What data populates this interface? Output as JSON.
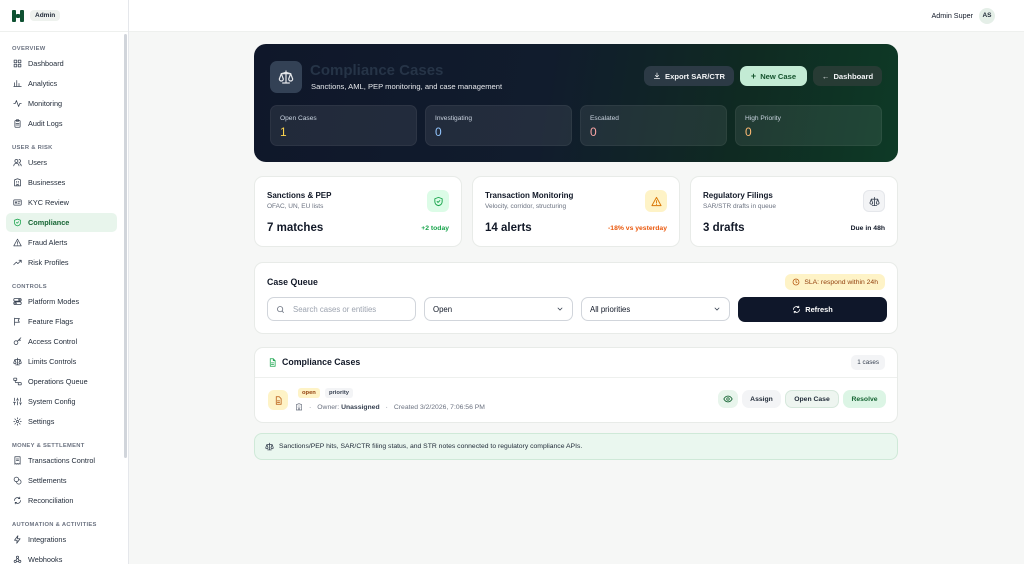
{
  "brand": {
    "badge": "Admin",
    "color": "#0f5132"
  },
  "topbar": {
    "user_name": "Admin Super",
    "avatar_initials": "AS"
  },
  "sidebar": {
    "sections": [
      {
        "title": "OVERVIEW",
        "items": [
          {
            "label": "Dashboard",
            "icon": "grid-icon"
          },
          {
            "label": "Analytics",
            "icon": "bar-chart-icon"
          },
          {
            "label": "Monitoring",
            "icon": "activity-icon"
          },
          {
            "label": "Audit Logs",
            "icon": "clipboard-icon"
          }
        ]
      },
      {
        "title": "USER & RISK",
        "items": [
          {
            "label": "Users",
            "icon": "users-icon"
          },
          {
            "label": "Businesses",
            "icon": "building-icon"
          },
          {
            "label": "KYC Review",
            "icon": "id-card-icon"
          },
          {
            "label": "Compliance",
            "icon": "shield-check-icon",
            "active": true
          },
          {
            "label": "Fraud Alerts",
            "icon": "alert-triangle-icon"
          },
          {
            "label": "Risk Profiles",
            "icon": "trending-up-icon"
          }
        ]
      },
      {
        "title": "CONTROLS",
        "items": [
          {
            "label": "Platform Modes",
            "icon": "toggles-icon"
          },
          {
            "label": "Feature Flags",
            "icon": "flag-icon"
          },
          {
            "label": "Access Control",
            "icon": "key-icon"
          },
          {
            "label": "Limits Controls",
            "icon": "scale-icon"
          },
          {
            "label": "Operations Queue",
            "icon": "workflow-icon"
          },
          {
            "label": "System Config",
            "icon": "sliders-icon"
          },
          {
            "label": "Settings",
            "icon": "gear-icon"
          }
        ]
      },
      {
        "title": "MONEY & SETTLEMENT",
        "items": [
          {
            "label": "Transactions Control",
            "icon": "receipt-icon"
          },
          {
            "label": "Settlements",
            "icon": "coins-icon"
          },
          {
            "label": "Reconciliation",
            "icon": "refresh-icon"
          }
        ]
      },
      {
        "title": "AUTOMATION & ACTIVITIES",
        "items": [
          {
            "label": "Integrations",
            "icon": "zap-icon"
          },
          {
            "label": "Webhooks",
            "icon": "webhook-icon"
          }
        ]
      }
    ]
  },
  "hero": {
    "title": "Compliance Cases",
    "subtitle": "Sanctions, AML, PEP monitoring, and case management",
    "export_label": "Export SAR/CTR",
    "new_case_label": "New Case",
    "dashboard_label": "Dashboard",
    "stats": [
      {
        "label": "Open Cases",
        "value": "1",
        "color": "#fcd34d"
      },
      {
        "label": "Investigating",
        "value": "0",
        "color": "#93c5fd"
      },
      {
        "label": "Escalated",
        "value": "0",
        "color": "#fca5a5"
      },
      {
        "label": "High Priority",
        "value": "0",
        "color": "#fdba74"
      }
    ]
  },
  "metrics": [
    {
      "title": "Sanctions & PEP",
      "subtitle": "OFAC, UN, EU lists",
      "value": "7 matches",
      "note": "+2 today",
      "note_color": "#16a34a",
      "icon": "shield-check-icon",
      "icon_bg": "#dcfce7"
    },
    {
      "title": "Transaction Monitoring",
      "subtitle": "Velocity, corridor, structuring",
      "value": "14 alerts",
      "note": "-18% vs yesterday",
      "note_color": "#ea580c",
      "icon": "alert-triangle-icon",
      "icon_bg": "#fef3c7"
    },
    {
      "title": "Regulatory Filings",
      "subtitle": "SAR/STR drafts in queue",
      "value": "3 drafts",
      "note": "Due in 48h",
      "note_color": "#111827",
      "icon": "scale-icon",
      "icon_bg": "#f3f4f6"
    }
  ],
  "queue": {
    "title": "Case Queue",
    "sla": "SLA: respond within 24h",
    "search_placeholder": "Search cases or entities",
    "status_value": "Open",
    "priority_value": "All priorities",
    "refresh_label": "Refresh"
  },
  "cases": {
    "title": "Compliance Cases",
    "count": "1 cases",
    "rows": [
      {
        "status": "open",
        "priority": "priority",
        "owner_label": "Owner:",
        "owner": "Unassigned",
        "created": "Created 3/2/2026, 7:06:56 PM"
      }
    ],
    "actions": {
      "assign": "Assign",
      "open": "Open Case",
      "resolve": "Resolve"
    }
  },
  "footer": {
    "text": "Sanctions/PEP hits, SAR/CTR filing status, and STR notes connected to regulatory compliance APIs."
  }
}
